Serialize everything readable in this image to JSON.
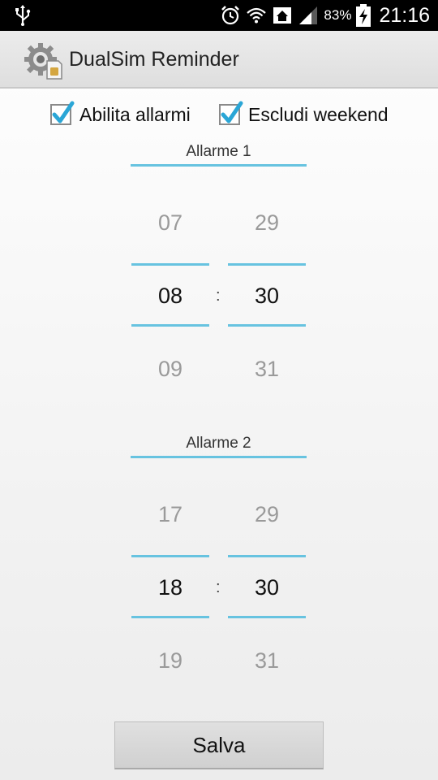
{
  "status_bar": {
    "battery_percent": "83%",
    "time": "21:16",
    "icons": [
      "usb-icon",
      "alarm-icon",
      "wifi-icon",
      "home-icon",
      "signal-icon",
      "battery-charging-icon"
    ]
  },
  "app": {
    "title": "DualSim Reminder",
    "icon": "dualsim-gear-icon"
  },
  "options": {
    "enable_alarms": {
      "label": "Abilita allarmi",
      "checked": true
    },
    "exclude_weekend": {
      "label": "Escludi weekend",
      "checked": true
    }
  },
  "alarms": [
    {
      "title": "Allarme 1",
      "hours": {
        "prev": "07",
        "current": "08",
        "next": "09"
      },
      "minutes": {
        "prev": "29",
        "current": "30",
        "next": "31"
      },
      "separator": ":"
    },
    {
      "title": "Allarme 2",
      "hours": {
        "prev": "17",
        "current": "18",
        "next": "19"
      },
      "minutes": {
        "prev": "29",
        "current": "30",
        "next": "31"
      },
      "separator": ":"
    }
  ],
  "save_button": {
    "label": "Salva"
  },
  "colors": {
    "accent": "#67c3e0",
    "check": "#2aa6d6",
    "statusbar": "#000000"
  }
}
